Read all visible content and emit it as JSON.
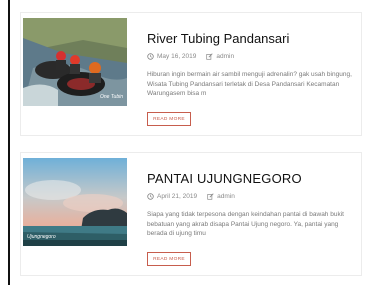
{
  "posts": [
    {
      "title": "River Tubing Pandansari",
      "date": "May 16, 2019",
      "author": "admin",
      "excerpt": "Hiburan ingin bermain air sambil menguji adrenalin? gak usah bingung, Wisata Tubing Pandansari terletak di Desa Pandansari Kecamatan Warungasem bisa m",
      "read_more": "READ MORE",
      "image_watermark": "One Tubin",
      "image_icon": "river-tubing-photo"
    },
    {
      "title": "PANTAI UJUNGNEGORO",
      "date": "April 21, 2019",
      "author": "admin",
      "excerpt": "Siapa yang tidak terpesona dengan keindahan pantai di bawah bukit bebatuan yang akrab disapa Pantai Ujung negoro. Ya, pantai yang berada di ujung timu",
      "read_more": "READ MORE",
      "image_watermark": "Ujungnegoro",
      "image_icon": "beach-sunset-photo"
    }
  ],
  "colors": {
    "accent": "#c75d4d",
    "title": "#111111",
    "meta": "#8a8a8a",
    "excerpt": "#7a7a7a"
  }
}
